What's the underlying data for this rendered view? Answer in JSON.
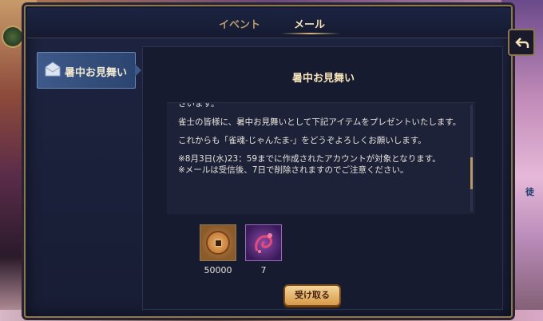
{
  "tabs": [
    {
      "label": "イベント"
    },
    {
      "label": "メール"
    }
  ],
  "sidebar": {
    "items": [
      {
        "label": "暑中お見舞い"
      }
    ]
  },
  "mail": {
    "title": "暑中お見舞い",
    "body_partial": "さいます。",
    "body": [
      "雀士の皆様に、暑中お見舞いとして下記アイテムをプレゼントいたします。",
      "これからも「雀魂-じゃんたま-」をどうぞよろしくお願いします。",
      "※8月3日(水)23：59までに作成されたアカウントが対象となります。",
      "※メールは受信後、7日で削除されますのでご注意ください。"
    ],
    "scroll_position": 0.7
  },
  "rewards": [
    {
      "icon": "coin-icon",
      "count": "50000"
    },
    {
      "icon": "item-icon",
      "count": "7"
    }
  ],
  "claim_button": {
    "label": "受け取る"
  },
  "side_text": "徒",
  "colors": {
    "accent": "#f4e2b8",
    "tab_inactive": "#b89a6a",
    "panel": "#161b30",
    "button": "#d89a4a"
  }
}
